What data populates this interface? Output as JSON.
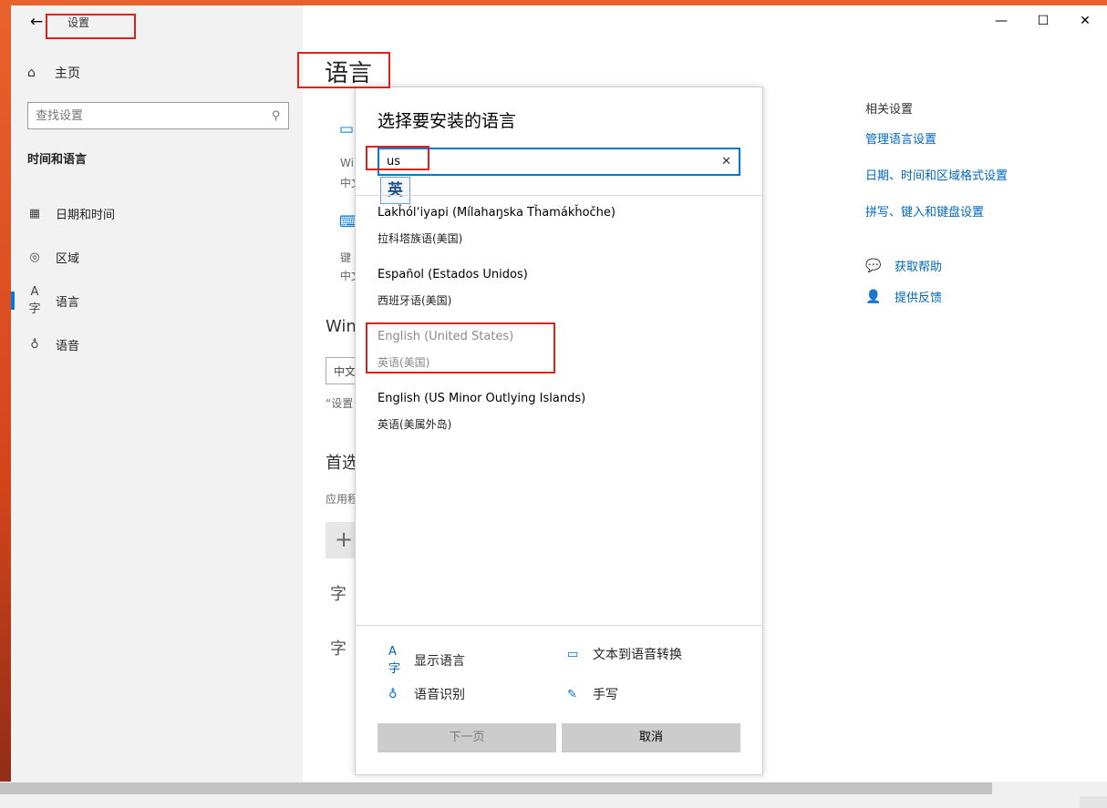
{
  "window": {
    "title": "设置",
    "back_icon": "←",
    "minimize_icon": "—",
    "maximize_icon": "☐",
    "close_icon": "✕"
  },
  "sidebar": {
    "home_label": "主页",
    "search_placeholder": "查找设置",
    "section_title": "时间和语言",
    "items": [
      {
        "label": "日期和时间",
        "icon": "calendar-clock-icon",
        "active": false
      },
      {
        "label": "区域",
        "icon": "globe-icon",
        "active": false
      },
      {
        "label": "语言",
        "icon": "language-icon",
        "active": true
      },
      {
        "label": "语音",
        "icon": "microphone-icon",
        "active": false
      }
    ]
  },
  "main": {
    "title": "语言",
    "fragments": {
      "a1": "Wi",
      "a2": "中文",
      "b1": "键",
      "b2": "中文",
      "win": "Win",
      "box": "中文",
      "quote": "“设置",
      "pref": "首选",
      "app": "应用程",
      "plus": "+",
      "zi": "字"
    }
  },
  "related": {
    "header": "相关设置",
    "links": [
      "管理语言设置",
      "日期、时间和区域格式设置",
      "拼写、键入和键盘设置"
    ],
    "help": "获取帮助",
    "feedback": "提供反馈"
  },
  "dialog": {
    "title": "选择要安装的语言",
    "search_value": "us",
    "clear_icon": "✕",
    "ime_candidate": "英",
    "languages": [
      {
        "en": "Lakȟólʼiyapi (Mílahaŋska Tȟamákȟočhe)",
        "zh": "拉科塔族语(美国)",
        "dim": false
      },
      {
        "en": "Español (Estados Unidos)",
        "zh": "西班牙语(美国)",
        "dim": false
      },
      {
        "en": "English (United States)",
        "zh": "英语(美国)",
        "dim": true
      },
      {
        "en": "English (US Minor Outlying Islands)",
        "zh": "英语(美属外岛)",
        "dim": false
      }
    ],
    "features": {
      "display": "显示语言",
      "tts": "文本到语音转换",
      "speech": "语音识别",
      "handwriting": "手写"
    },
    "next_label": "下一页",
    "cancel_label": "取消"
  },
  "colors": {
    "accent": "#0078d7",
    "link": "#0067c0",
    "annotation": "#e0201a"
  }
}
